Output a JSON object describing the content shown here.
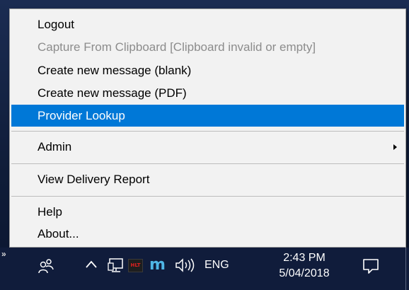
{
  "menu": {
    "items": [
      {
        "label": "Logout",
        "state": "normal"
      },
      {
        "label": "Capture From Clipboard [Clipboard invalid or empty]",
        "state": "disabled"
      },
      {
        "label": "Create new message (blank)",
        "state": "normal"
      },
      {
        "label": "Create new message (PDF)",
        "state": "normal"
      },
      {
        "label": "Provider Lookup",
        "state": "selected"
      },
      {
        "label": "Admin",
        "state": "normal",
        "has_submenu": true
      },
      {
        "label": "View Delivery Report",
        "state": "normal"
      },
      {
        "label": "Help",
        "state": "normal"
      },
      {
        "label": "About...",
        "state": "normal"
      }
    ],
    "highlight_color": "#0078d7",
    "disabled_color": "#8c8c8c"
  },
  "taskbar": {
    "overflow_chevrons": "»",
    "tray_icons": [
      "people-icon",
      "show-hidden-icons-caret",
      "network-icon",
      "hlt-app-icon",
      "m-app-icon",
      "volume-icon"
    ],
    "hlt_badge": "HLT",
    "m_badge": "m",
    "language": "ENG",
    "time": "2:43 PM",
    "date": "5/04/2018",
    "background_color": "#101c3b"
  }
}
